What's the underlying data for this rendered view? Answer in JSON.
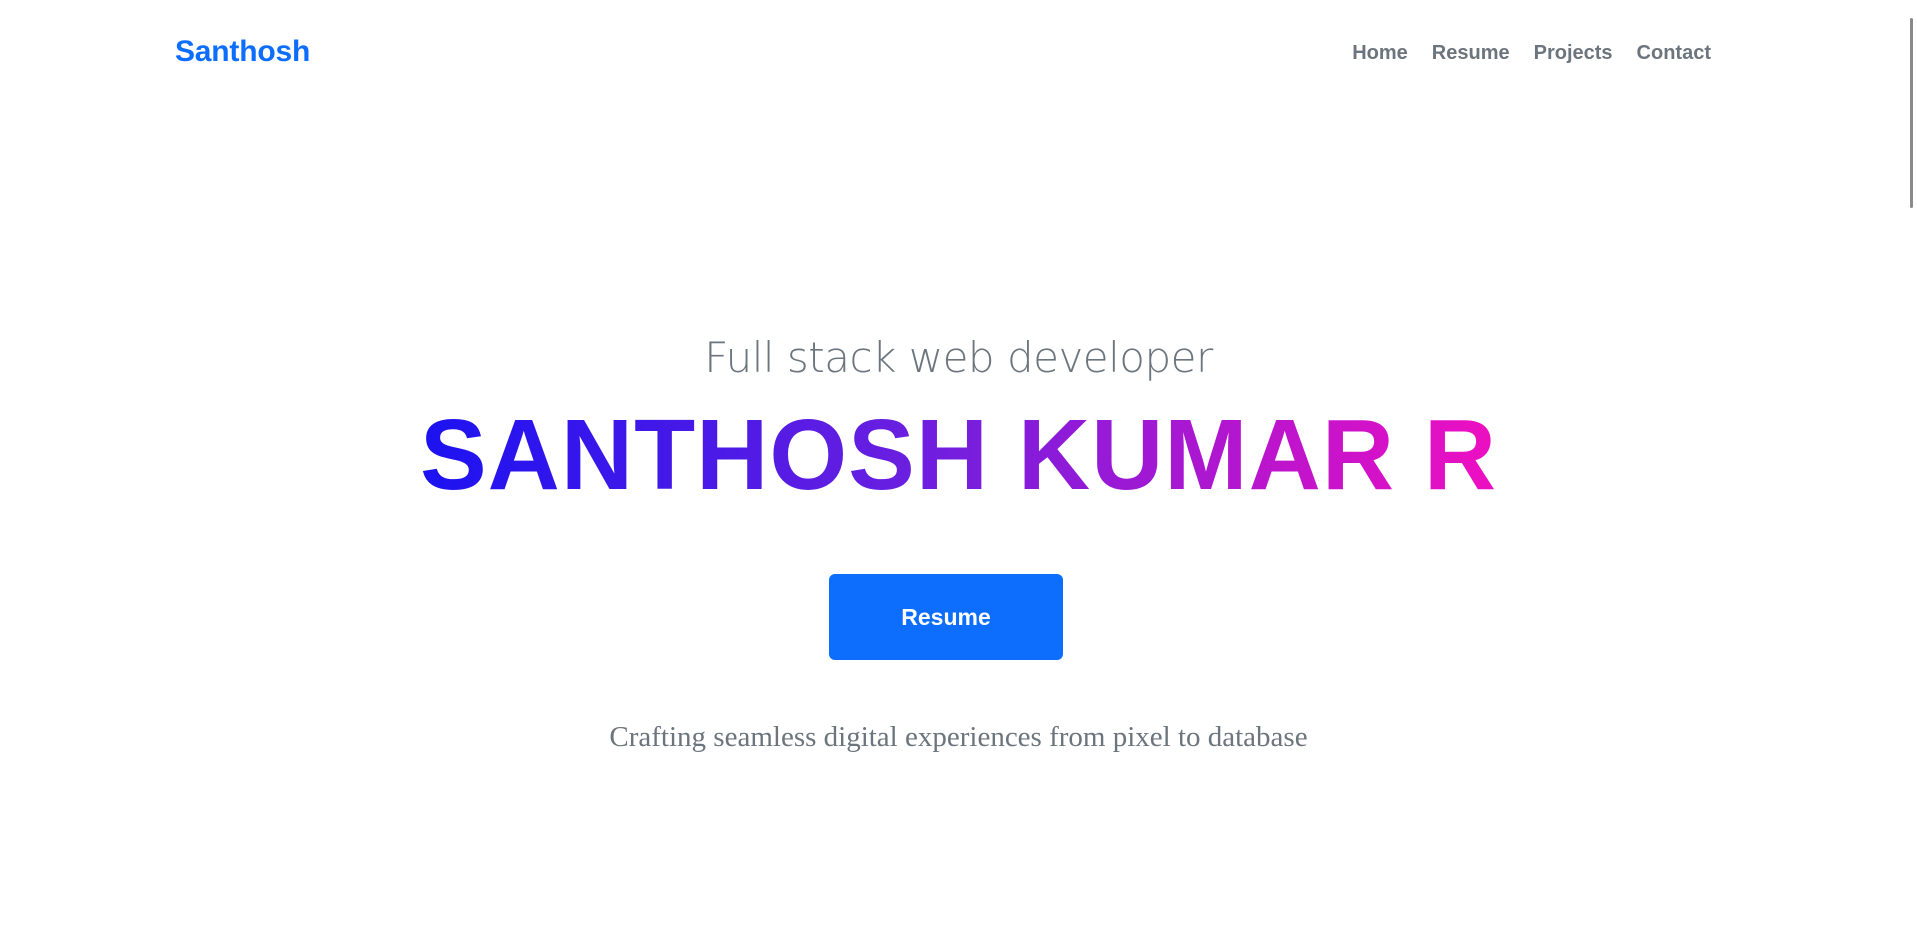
{
  "navbar": {
    "brand": "Santhosh",
    "links": [
      {
        "label": "Home"
      },
      {
        "label": "Resume"
      },
      {
        "label": "Projects"
      },
      {
        "label": "Contact"
      }
    ]
  },
  "hero": {
    "subtitle": "Full stack web developer",
    "name": "SANTHOSH KUMAR R",
    "button_label": "Resume",
    "tagline": "Crafting seamless digital experiences from pixel to database"
  },
  "colors": {
    "accent": "#0d6efd",
    "muted_text": "#6c757d",
    "gradient_start": "#1b12f1",
    "gradient_end": "#ee0fc1"
  }
}
